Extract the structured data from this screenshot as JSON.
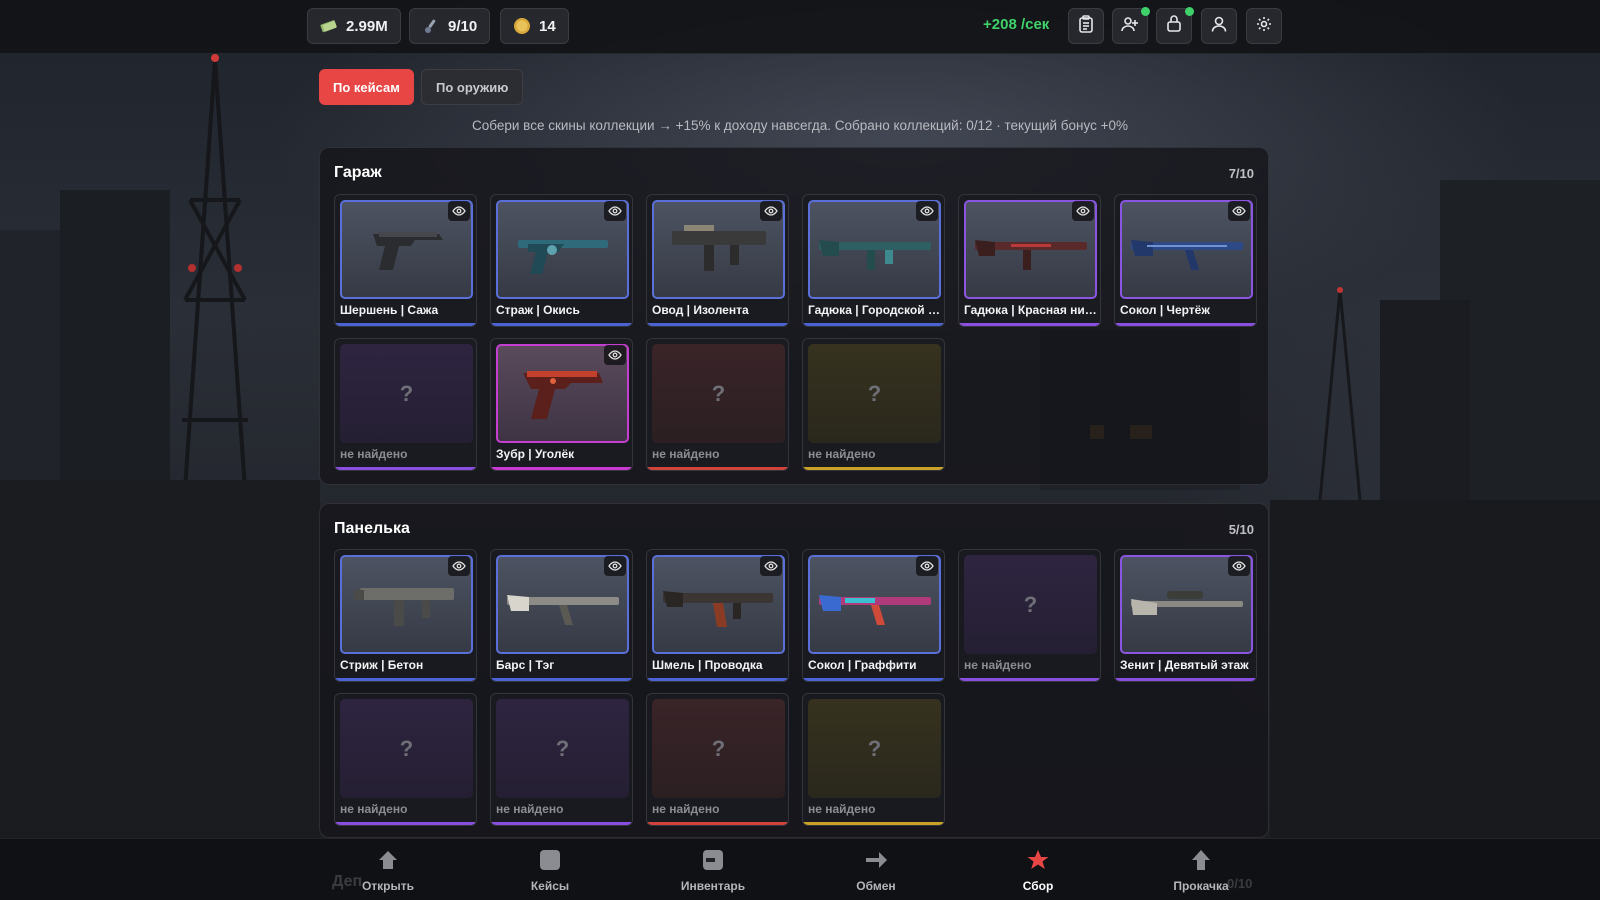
{
  "topbar": {
    "money": "2.99M",
    "keys": "9/10",
    "coins": "14",
    "rate": "+208 /сек",
    "icons": [
      "money-icon",
      "key-icon",
      "coin-icon",
      "clipboard-icon",
      "add-friend-icon",
      "lock-icon",
      "profile-icon",
      "settings-icon"
    ],
    "accent_green": "#3fd26b"
  },
  "tabs": {
    "by_case": "По кейсам",
    "by_weapon": "По оружию"
  },
  "hint": "Собери все скины коллекции → +15% к доходу навсегда. Собрано коллекций: 0/12 · текущий бонус +0%",
  "collections": [
    {
      "title": "Гараж",
      "count": "7/10",
      "items": [
        {
          "name": "Шершень | Сажа",
          "rarity": "blue",
          "found": true
        },
        {
          "name": "Страж | Окись",
          "rarity": "blue",
          "found": true
        },
        {
          "name": "Овод | Изолента",
          "rarity": "blue",
          "found": true
        },
        {
          "name": "Гадюка | Городской к...",
          "rarity": "blue",
          "found": true
        },
        {
          "name": "Гадюка | Красная нить",
          "rarity": "purple",
          "found": true
        },
        {
          "name": "Сокол | Чертёж",
          "rarity": "purple",
          "found": true
        },
        {
          "name": "не найдено",
          "rarity": "purple",
          "found": false
        },
        {
          "name": "Зубр | Уголёк",
          "rarity": "pink",
          "found": true
        },
        {
          "name": "не найдено",
          "rarity": "red",
          "found": false
        },
        {
          "name": "не найдено",
          "rarity": "gold",
          "found": false
        }
      ]
    },
    {
      "title": "Панелька",
      "count": "5/10",
      "items": [
        {
          "name": "Стриж | Бетон",
          "rarity": "blue",
          "found": true
        },
        {
          "name": "Барс | Тэг",
          "rarity": "blue",
          "found": true
        },
        {
          "name": "Шмель | Проводка",
          "rarity": "blue",
          "found": true
        },
        {
          "name": "Сокол | Граффити",
          "rarity": "blue",
          "found": true
        },
        {
          "name": "не найдено",
          "rarity": "purple",
          "found": false
        },
        {
          "name": "Зенит | Девятый этаж",
          "rarity": "purple",
          "found": true
        },
        {
          "name": "не найдено",
          "rarity": "purple",
          "found": false
        },
        {
          "name": "не найдено",
          "rarity": "purple",
          "found": false
        },
        {
          "name": "не найдено",
          "rarity": "red",
          "found": false
        },
        {
          "name": "не найдено",
          "rarity": "gold",
          "found": false
        }
      ]
    }
  ],
  "missing_mark": "?",
  "next_collection_peek": {
    "title": "Деп",
    "count": "0/10"
  },
  "nav": [
    {
      "label": "Открыть",
      "icon": "house-icon",
      "active": false
    },
    {
      "label": "Кейсы",
      "icon": "case-icon",
      "active": false
    },
    {
      "label": "Инвентарь",
      "icon": "inventory-icon",
      "active": false
    },
    {
      "label": "Обмен",
      "icon": "arrow-right-icon",
      "active": false
    },
    {
      "label": "Сбор",
      "icon": "star-icon",
      "active": true
    },
    {
      "label": "Прокачка",
      "icon": "arrow-up-icon",
      "active": false
    }
  ],
  "colors": {
    "active_tab": "#e84545",
    "rarity_blue": "#4c63d6",
    "rarity_purple": "#8a4fe0",
    "rarity_pink": "#c93ad2",
    "rarity_red": "#d0443c",
    "rarity_gold": "#c9a227",
    "active_nav_star": "#e84545"
  }
}
